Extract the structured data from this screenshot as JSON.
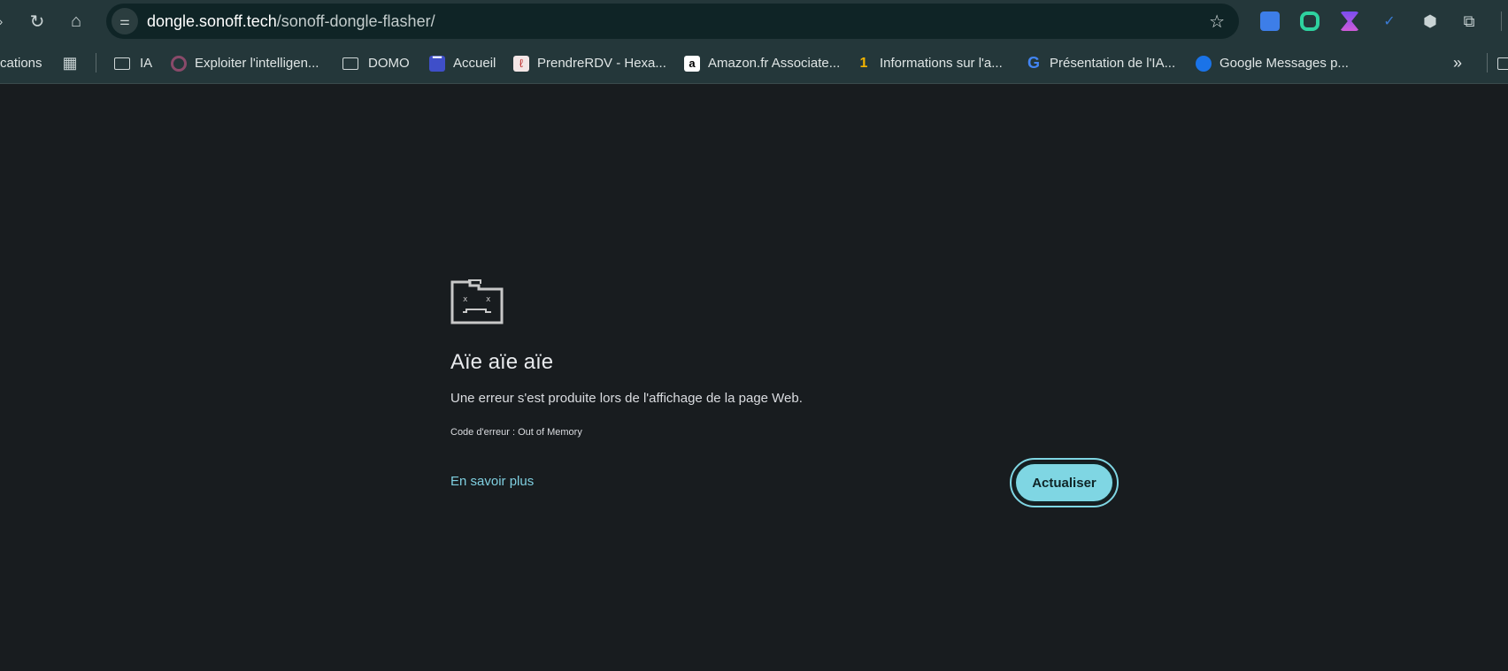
{
  "toolbar": {
    "url_host": "dongle.sonoff.tech",
    "url_path": "/sonoff-dongle-flasher/"
  },
  "bookmarks": [
    {
      "label": "cations"
    },
    {
      "label": "IA"
    },
    {
      "label": "Exploiter l'intelligen..."
    },
    {
      "label": "DOMO"
    },
    {
      "label": "Accueil"
    },
    {
      "label": "PrendreRDV - Hexa..."
    },
    {
      "label": "Amazon.fr Associate..."
    },
    {
      "label": "Informations sur l'a..."
    },
    {
      "label": "Présentation de l'IA..."
    },
    {
      "label": "Google Messages p..."
    }
  ],
  "overflow_label": "»",
  "error": {
    "title": "Aïe aïe aïe",
    "description": "Une erreur s'est produite lors de l'affichage de la page Web.",
    "code": "Code d'erreur : Out of Memory",
    "learn_more": "En savoir plus",
    "reload": "Actualiser"
  },
  "colors": {
    "accent": "#7fd6e3",
    "page_bg": "#181c1f",
    "toolbar_bg": "#24373a"
  }
}
